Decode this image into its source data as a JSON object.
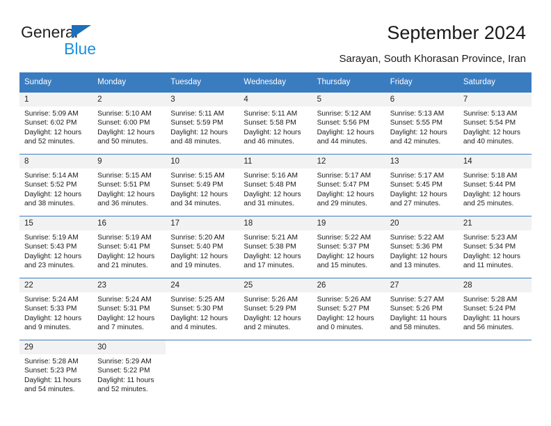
{
  "brand": {
    "name_top": "General",
    "name_bottom": "Blue",
    "colors": {
      "dark": "#221f1f",
      "blue": "#1c8fe0",
      "triangle": "#1c6fba"
    }
  },
  "header": {
    "title": "September 2024",
    "subtitle": "Sarayan, South Khorasan Province, Iran"
  },
  "theme": {
    "header_bg": "#3a7cc0",
    "daynum_bg": "#f2f2f2",
    "rule": "#3a7cc0"
  },
  "weekdays": [
    "Sunday",
    "Monday",
    "Tuesday",
    "Wednesday",
    "Thursday",
    "Friday",
    "Saturday"
  ],
  "labels": {
    "sunrise_prefix": "Sunrise:",
    "sunset_prefix": "Sunset:",
    "daylight_prefix": "Daylight:"
  },
  "weeks": [
    [
      {
        "day": "1",
        "sunrise": "Sunrise: 5:09 AM",
        "sunset": "Sunset: 6:02 PM",
        "daylight1": "Daylight: 12 hours",
        "daylight2": "and 52 minutes."
      },
      {
        "day": "2",
        "sunrise": "Sunrise: 5:10 AM",
        "sunset": "Sunset: 6:00 PM",
        "daylight1": "Daylight: 12 hours",
        "daylight2": "and 50 minutes."
      },
      {
        "day": "3",
        "sunrise": "Sunrise: 5:11 AM",
        "sunset": "Sunset: 5:59 PM",
        "daylight1": "Daylight: 12 hours",
        "daylight2": "and 48 minutes."
      },
      {
        "day": "4",
        "sunrise": "Sunrise: 5:11 AM",
        "sunset": "Sunset: 5:58 PM",
        "daylight1": "Daylight: 12 hours",
        "daylight2": "and 46 minutes."
      },
      {
        "day": "5",
        "sunrise": "Sunrise: 5:12 AM",
        "sunset": "Sunset: 5:56 PM",
        "daylight1": "Daylight: 12 hours",
        "daylight2": "and 44 minutes."
      },
      {
        "day": "6",
        "sunrise": "Sunrise: 5:13 AM",
        "sunset": "Sunset: 5:55 PM",
        "daylight1": "Daylight: 12 hours",
        "daylight2": "and 42 minutes."
      },
      {
        "day": "7",
        "sunrise": "Sunrise: 5:13 AM",
        "sunset": "Sunset: 5:54 PM",
        "daylight1": "Daylight: 12 hours",
        "daylight2": "and 40 minutes."
      }
    ],
    [
      {
        "day": "8",
        "sunrise": "Sunrise: 5:14 AM",
        "sunset": "Sunset: 5:52 PM",
        "daylight1": "Daylight: 12 hours",
        "daylight2": "and 38 minutes."
      },
      {
        "day": "9",
        "sunrise": "Sunrise: 5:15 AM",
        "sunset": "Sunset: 5:51 PM",
        "daylight1": "Daylight: 12 hours",
        "daylight2": "and 36 minutes."
      },
      {
        "day": "10",
        "sunrise": "Sunrise: 5:15 AM",
        "sunset": "Sunset: 5:49 PM",
        "daylight1": "Daylight: 12 hours",
        "daylight2": "and 34 minutes."
      },
      {
        "day": "11",
        "sunrise": "Sunrise: 5:16 AM",
        "sunset": "Sunset: 5:48 PM",
        "daylight1": "Daylight: 12 hours",
        "daylight2": "and 31 minutes."
      },
      {
        "day": "12",
        "sunrise": "Sunrise: 5:17 AM",
        "sunset": "Sunset: 5:47 PM",
        "daylight1": "Daylight: 12 hours",
        "daylight2": "and 29 minutes."
      },
      {
        "day": "13",
        "sunrise": "Sunrise: 5:17 AM",
        "sunset": "Sunset: 5:45 PM",
        "daylight1": "Daylight: 12 hours",
        "daylight2": "and 27 minutes."
      },
      {
        "day": "14",
        "sunrise": "Sunrise: 5:18 AM",
        "sunset": "Sunset: 5:44 PM",
        "daylight1": "Daylight: 12 hours",
        "daylight2": "and 25 minutes."
      }
    ],
    [
      {
        "day": "15",
        "sunrise": "Sunrise: 5:19 AM",
        "sunset": "Sunset: 5:43 PM",
        "daylight1": "Daylight: 12 hours",
        "daylight2": "and 23 minutes."
      },
      {
        "day": "16",
        "sunrise": "Sunrise: 5:19 AM",
        "sunset": "Sunset: 5:41 PM",
        "daylight1": "Daylight: 12 hours",
        "daylight2": "and 21 minutes."
      },
      {
        "day": "17",
        "sunrise": "Sunrise: 5:20 AM",
        "sunset": "Sunset: 5:40 PM",
        "daylight1": "Daylight: 12 hours",
        "daylight2": "and 19 minutes."
      },
      {
        "day": "18",
        "sunrise": "Sunrise: 5:21 AM",
        "sunset": "Sunset: 5:38 PM",
        "daylight1": "Daylight: 12 hours",
        "daylight2": "and 17 minutes."
      },
      {
        "day": "19",
        "sunrise": "Sunrise: 5:22 AM",
        "sunset": "Sunset: 5:37 PM",
        "daylight1": "Daylight: 12 hours",
        "daylight2": "and 15 minutes."
      },
      {
        "day": "20",
        "sunrise": "Sunrise: 5:22 AM",
        "sunset": "Sunset: 5:36 PM",
        "daylight1": "Daylight: 12 hours",
        "daylight2": "and 13 minutes."
      },
      {
        "day": "21",
        "sunrise": "Sunrise: 5:23 AM",
        "sunset": "Sunset: 5:34 PM",
        "daylight1": "Daylight: 12 hours",
        "daylight2": "and 11 minutes."
      }
    ],
    [
      {
        "day": "22",
        "sunrise": "Sunrise: 5:24 AM",
        "sunset": "Sunset: 5:33 PM",
        "daylight1": "Daylight: 12 hours",
        "daylight2": "and 9 minutes."
      },
      {
        "day": "23",
        "sunrise": "Sunrise: 5:24 AM",
        "sunset": "Sunset: 5:31 PM",
        "daylight1": "Daylight: 12 hours",
        "daylight2": "and 7 minutes."
      },
      {
        "day": "24",
        "sunrise": "Sunrise: 5:25 AM",
        "sunset": "Sunset: 5:30 PM",
        "daylight1": "Daylight: 12 hours",
        "daylight2": "and 4 minutes."
      },
      {
        "day": "25",
        "sunrise": "Sunrise: 5:26 AM",
        "sunset": "Sunset: 5:29 PM",
        "daylight1": "Daylight: 12 hours",
        "daylight2": "and 2 minutes."
      },
      {
        "day": "26",
        "sunrise": "Sunrise: 5:26 AM",
        "sunset": "Sunset: 5:27 PM",
        "daylight1": "Daylight: 12 hours",
        "daylight2": "and 0 minutes."
      },
      {
        "day": "27",
        "sunrise": "Sunrise: 5:27 AM",
        "sunset": "Sunset: 5:26 PM",
        "daylight1": "Daylight: 11 hours",
        "daylight2": "and 58 minutes."
      },
      {
        "day": "28",
        "sunrise": "Sunrise: 5:28 AM",
        "sunset": "Sunset: 5:24 PM",
        "daylight1": "Daylight: 11 hours",
        "daylight2": "and 56 minutes."
      }
    ],
    [
      {
        "day": "29",
        "sunrise": "Sunrise: 5:28 AM",
        "sunset": "Sunset: 5:23 PM",
        "daylight1": "Daylight: 11 hours",
        "daylight2": "and 54 minutes."
      },
      {
        "day": "30",
        "sunrise": "Sunrise: 5:29 AM",
        "sunset": "Sunset: 5:22 PM",
        "daylight1": "Daylight: 11 hours",
        "daylight2": "and 52 minutes."
      },
      {
        "day": "",
        "sunrise": "",
        "sunset": "",
        "daylight1": "",
        "daylight2": ""
      },
      {
        "day": "",
        "sunrise": "",
        "sunset": "",
        "daylight1": "",
        "daylight2": ""
      },
      {
        "day": "",
        "sunrise": "",
        "sunset": "",
        "daylight1": "",
        "daylight2": ""
      },
      {
        "day": "",
        "sunrise": "",
        "sunset": "",
        "daylight1": "",
        "daylight2": ""
      },
      {
        "day": "",
        "sunrise": "",
        "sunset": "",
        "daylight1": "",
        "daylight2": ""
      }
    ]
  ]
}
